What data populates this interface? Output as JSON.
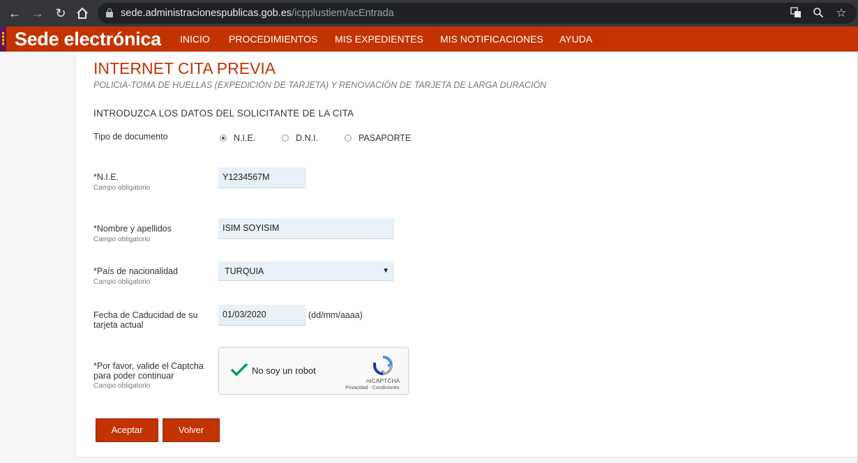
{
  "browser": {
    "url_host": "sede.administracionespublicas.gob.es",
    "url_path": "/icpplustiem/acEntrada"
  },
  "header": {
    "brand": "Sede electrónica",
    "menu": [
      "INICIO",
      "PROCEDIMIENTOS",
      "MIS EXPEDIENTES",
      "MIS NOTIFICACIONES",
      "AYUDA"
    ]
  },
  "page": {
    "title": "INTERNET CITA PREVIA",
    "subtitle": "POLICIA-TOMA DE HUELLAS (EXPEDICIÓN DE TARJETA) Y RENOVACIÓN DE TARJETA DE LARGA DURACIÓN",
    "section": "INTRODUZCA LOS DATOS DEL SOLICITANTE DE LA CITA"
  },
  "form": {
    "required_hint": "Campo obligatorio",
    "doc_type": {
      "label": "Tipo de documento",
      "options": [
        "N.I.E.",
        "D.N.I.",
        "PASAPORTE"
      ],
      "selected": "N.I.E."
    },
    "nie": {
      "label": "*N.I.E.",
      "value": "Y1234567M"
    },
    "name": {
      "label": "*Nombre y apellidos",
      "value": "ISIM SOYISIM"
    },
    "country": {
      "label": "*País de nacionalidad",
      "value": "TURQUIA"
    },
    "expiry": {
      "label_line1": "Fecha de Caducidad de su",
      "label_line2": "tarjeta actual",
      "value": "01/03/2020",
      "format_hint": "(dd/mm/aaaa)"
    },
    "captcha": {
      "label_line1": "*Por favor, valide el Captcha",
      "label_line2": "para poder continuar",
      "checkbox_text": "No soy un robot",
      "brand": "reCAPTCHA",
      "links": "Privacidad - Condiciones"
    },
    "buttons": {
      "accept": "Aceptar",
      "back": "Volver"
    }
  },
  "colors": {
    "brand_red": "#c33300",
    "field_bg": "#e8f0f8",
    "check_green": "#009e55"
  }
}
